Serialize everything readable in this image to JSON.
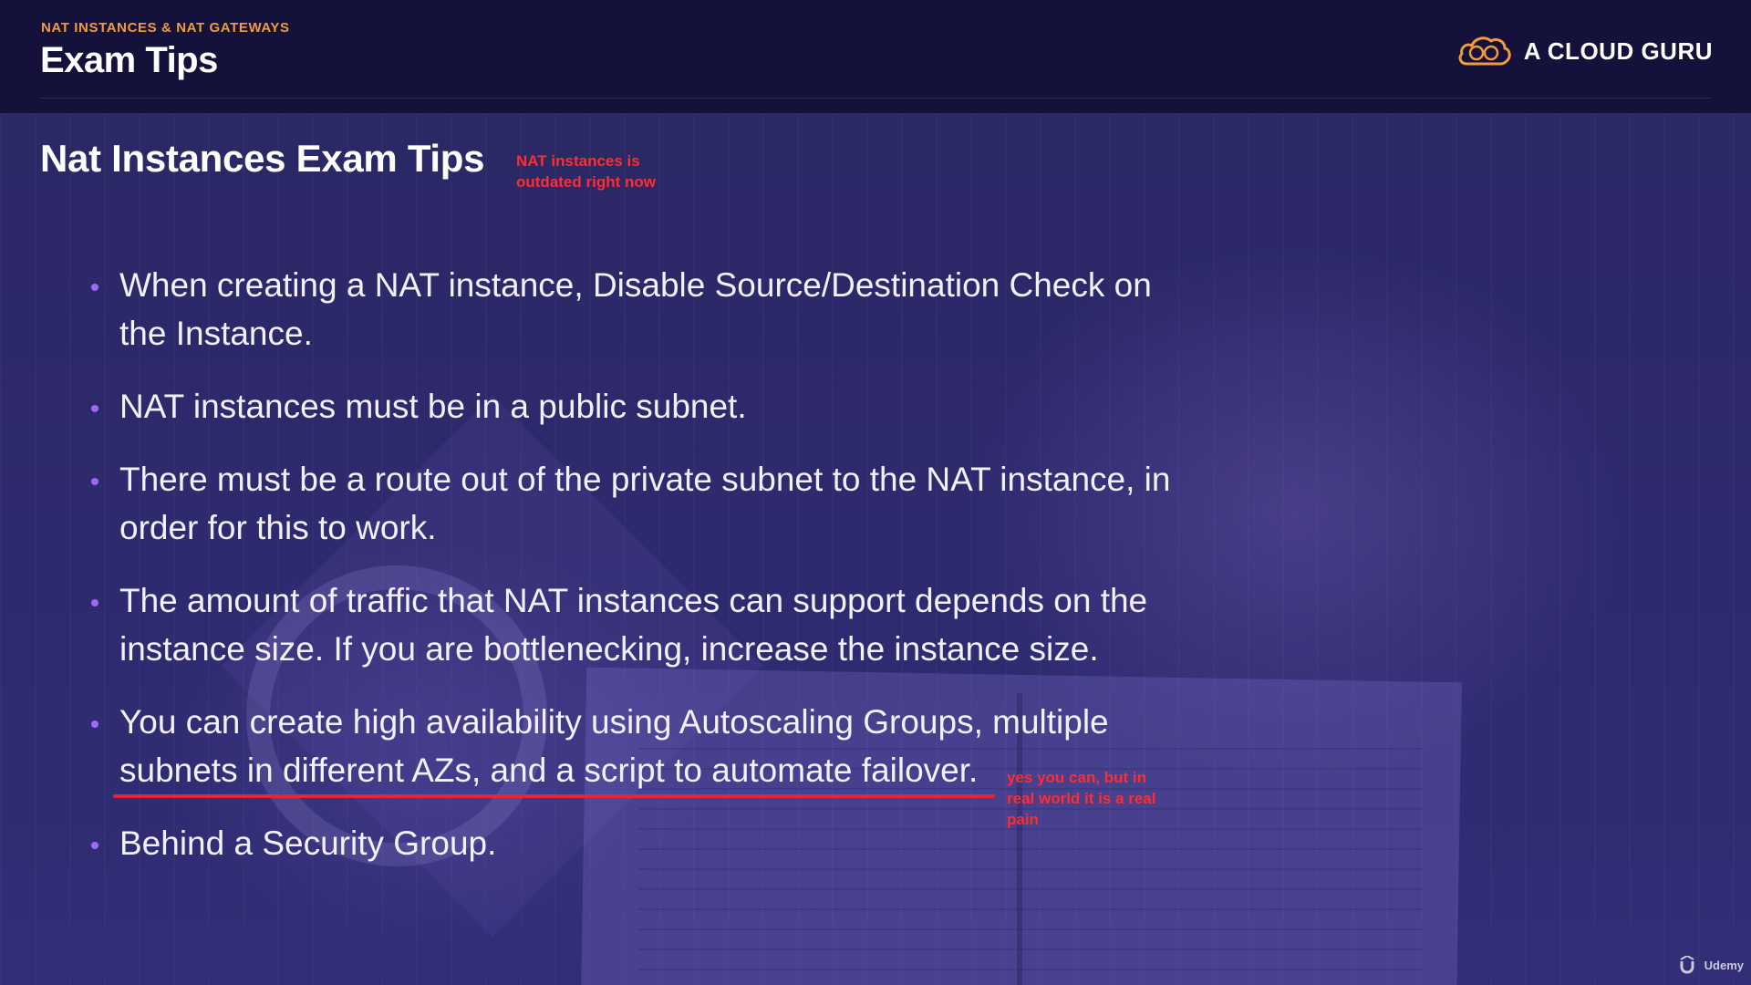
{
  "header": {
    "eyebrow": "NAT INSTANCES & NAT GATEWAYS",
    "title": "Exam Tips",
    "brand_name": "A CLOUD GURU"
  },
  "content": {
    "title": "Nat Instances Exam Tips",
    "bullets": [
      "When creating a NAT instance, Disable Source/Destination Check on the Instance.",
      "NAT instances must be in a public subnet.",
      "There must be a route out of the private subnet to the NAT instance, in order for this to work.",
      "The amount of traffic that NAT instances can support depends on the instance size. If you are bottlenecking, increase the instance size.",
      "You can create high availability using Autoscaling Groups, multiple subnets in different AZs, and a script to automate failover.",
      "Behind a Security Group."
    ]
  },
  "annotations": {
    "title_note": "NAT instances is outdated right now",
    "failover_note": "yes you can, but in real world it is a real pain"
  },
  "watermark": {
    "label": "Udemy"
  },
  "colors": {
    "header_bg": "#14113a",
    "eyebrow": "#f29a3e",
    "bullet_dot": "#9a6cf5",
    "annotation_red": "#ff2d2d",
    "logo_orange": "#f29a3e"
  }
}
